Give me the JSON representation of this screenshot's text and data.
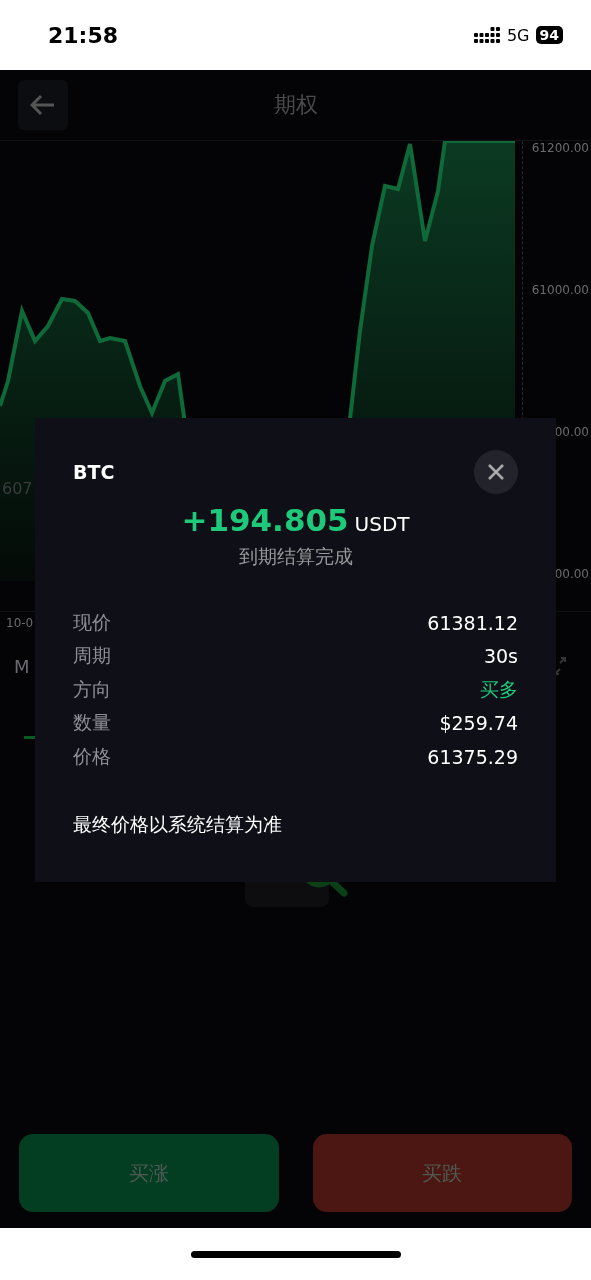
{
  "status_bar": {
    "time": "21:58",
    "network": "5G",
    "battery": "94"
  },
  "header": {
    "title": "期权"
  },
  "chart": {
    "y_labels": [
      "61200.00",
      "61000.00",
      "00.00",
      "00.00"
    ],
    "price_tag": "607",
    "x_label": "10-0",
    "interval_tab": "M"
  },
  "modal": {
    "symbol": "BTC",
    "profit": "+194.805",
    "unit": "USDT",
    "status": "到期结算完成",
    "rows": [
      {
        "label": "现价",
        "value": "61381.12",
        "kind": "plain"
      },
      {
        "label": "周期",
        "value": "30s",
        "kind": "plain"
      },
      {
        "label": "方向",
        "value": "买多",
        "kind": "up"
      },
      {
        "label": "数量",
        "value": "$259.74",
        "kind": "plain"
      },
      {
        "label": "价格",
        "value": "61375.29",
        "kind": "plain"
      }
    ],
    "note": "最终价格以系统结算为准"
  },
  "actions": [
    {
      "label": "买涨",
      "kind": "up"
    },
    {
      "label": "买跌",
      "kind": "down"
    }
  ]
}
